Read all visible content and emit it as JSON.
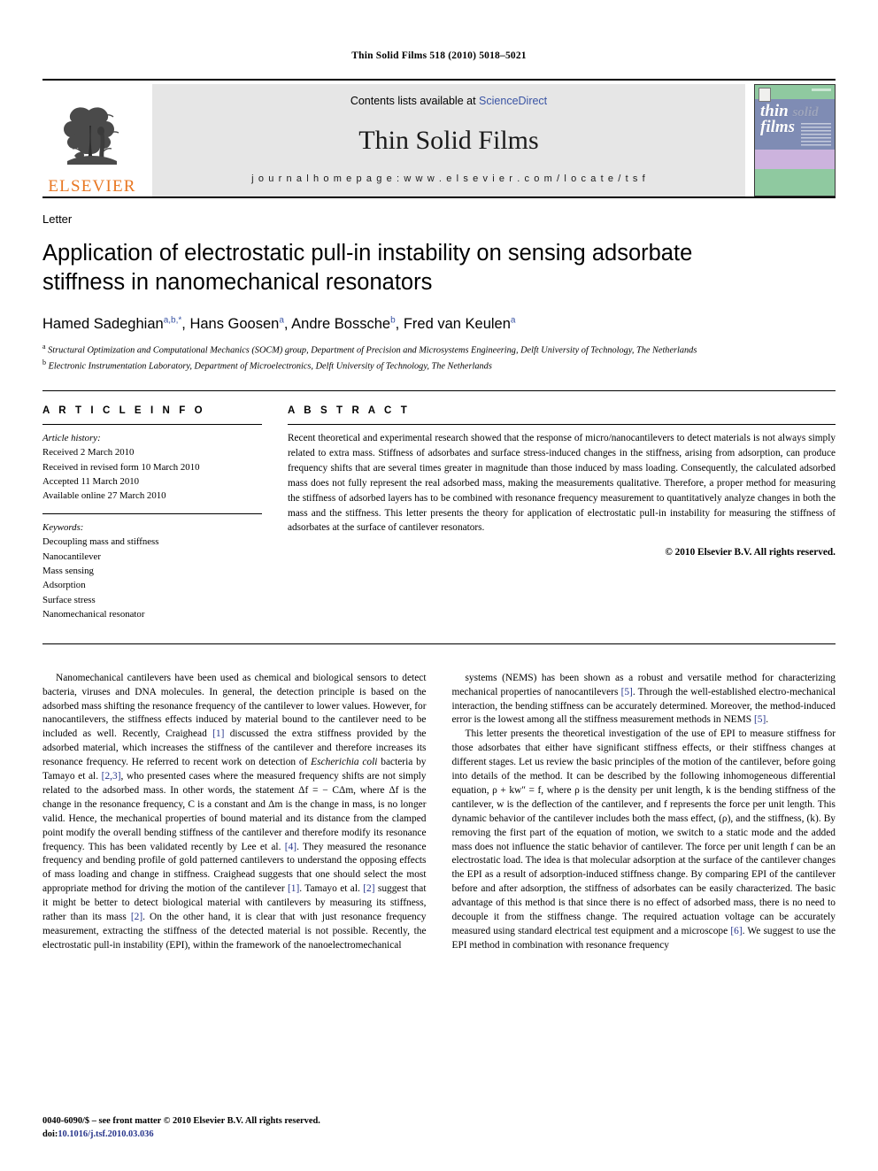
{
  "running_head": "Thin Solid Films 518 (2010) 5018–5021",
  "masthead": {
    "publisher_name": "ELSEVIER",
    "contents_prefix": "Contents lists available at",
    "contents_link": "ScienceDirect",
    "journal_title": "Thin Solid Films",
    "homepage_line": "j o u r n a l   h o m e p a g e :   w w w . e l s e v i e r . c o m / l o c a t e / t s f",
    "cover_word_1": "thin",
    "cover_word_faded": "solid",
    "cover_word_2": "films"
  },
  "article": {
    "section_type": "Letter",
    "title": "Application of electrostatic pull-in instability on sensing adsorbate stiffness in nanomechanical resonators",
    "authors": [
      {
        "name": "Hamed Sadeghian",
        "marks": "a,b,*",
        "sep": ", "
      },
      {
        "name": "Hans Goosen",
        "marks": "a",
        "sep": ", "
      },
      {
        "name": "Andre Bossche",
        "marks": "b",
        "sep": ", "
      },
      {
        "name": "Fred van Keulen",
        "marks": "a",
        "sep": ""
      }
    ],
    "affiliations": [
      {
        "mark": "a",
        "text": "Structural Optimization and Computational Mechanics (SOCM) group, Department of Precision and Microsystems Engineering, Delft University of Technology, The Netherlands"
      },
      {
        "mark": "b",
        "text": "Electronic Instrumentation Laboratory, Department of Microelectronics, Delft University of Technology, The Netherlands"
      }
    ]
  },
  "info": {
    "heading": "A R T I C L E   I N F O",
    "history_label": "Article history:",
    "history": [
      "Received 2 March 2010",
      "Received in revised form 10 March 2010",
      "Accepted 11 March 2010",
      "Available online 27 March 2010"
    ],
    "keywords_label": "Keywords:",
    "keywords": [
      "Decoupling mass and stiffness",
      "Nanocantilever",
      "Mass sensing",
      "Adsorption",
      "Surface stress",
      "Nanomechanical resonator"
    ]
  },
  "abstract": {
    "heading": "A B S T R A C T",
    "text": "Recent theoretical and experimental research showed that the response of micro/nanocantilevers to detect materials is not always simply related to extra mass. Stiffness of adsorbates and surface stress-induced changes in the stiffness, arising from adsorption, can produce frequency shifts that are several times greater in magnitude than those induced by mass loading. Consequently, the calculated adsorbed mass does not fully represent the real adsorbed mass, making the measurements qualitative. Therefore, a proper method for measuring the stiffness of adsorbed layers has to be combined with resonance frequency measurement to quantitatively analyze changes in both the mass and the stiffness. This letter presents the theory for application of electrostatic pull-in instability for measuring the stiffness of adsorbates at the surface of cantilever resonators.",
    "copyright": "© 2010 Elsevier B.V. All rights reserved."
  },
  "body": {
    "left_paragraph_1": "Nanomechanical cantilevers have been used as chemical and biological sensors to detect bacteria, viruses and DNA molecules. In general, the detection principle is based on the adsorbed mass shifting the resonance frequency of the cantilever to lower values. However, for nanocantilevers, the stiffness effects induced by material bound to the cantilever need to be included as well. Recently, Craighead [1] discussed the extra stiffness provided by the adsorbed material, which increases the stiffness of the cantilever and therefore increases its resonance frequency. He referred to recent work on detection of Escherichia coli bacteria by Tamayo et al. [2,3], who presented cases where the measured frequency shifts are not simply related to the adsorbed mass. In other words, the statement Δf = − CΔm, where Δf is the change in the resonance frequency, C is a constant and Δm is the change in mass, is no longer valid. Hence, the mechanical properties of bound material and its distance from the clamped point modify the overall bending stiffness of the cantilever and therefore modify its resonance frequency. This has been validated recently by Lee et al. [4]. They measured the resonance frequency and bending profile of gold patterned cantilevers to understand the opposing effects of mass loading and change in stiffness. Craighead suggests that one should select the most appropriate method for driving the motion of the cantilever [1]. Tamayo et al. [2] suggest that it might be better to detect biological material with cantilevers by measuring its stiffness, rather than its mass [2]. On the other hand, it is clear that with just resonance frequency measurement, extracting the stiffness of the detected material is not possible. Recently, the electrostatic pull-in instability (EPI), within the framework of the nanoelectromechanical",
    "right_paragraph_1": "systems (NEMS) has been shown as a robust and versatile method for characterizing mechanical properties of nanocantilevers [5]. Through the well-established electro-mechanical interaction, the bending stiffness can be accurately determined. Moreover, the method-induced error is the lowest among all the stiffness measurement methods in NEMS [5].",
    "right_paragraph_2": "This letter presents the theoretical investigation of the use of EPI to measure stiffness for those adsorbates that either have significant stiffness effects, or their stiffness changes at different stages. Let us review the basic principles of the motion of the cantilever, before going into details of the method. It can be described by the following inhomogeneous differential equation, ρ + kw″ = f, where ρ is the density per unit length, k is the bending stiffness of the cantilever, w is the deflection of the cantilever, and f represents the force per unit length. This dynamic behavior of the cantilever includes both the mass effect, (ρ), and the stiffness, (k). By removing the first part of the equation of motion, we switch to a static mode and the added mass does not influence the static behavior of cantilever. The force per unit length f can be an electrostatic load. The idea is that molecular adsorption at the surface of the cantilever changes the EPI as a result of adsorption-induced stiffness change. By comparing EPI of the cantilever before and after adsorption, the stiffness of adsorbates can be easily characterized. The basic advantage of this method is that since there is no effect of adsorbed mass, there is no need to decouple it from the stiffness change. The required actuation voltage can be accurately measured using standard electrical test equipment and a microscope [6]. We suggest to use the EPI method in combination with resonance frequency"
  },
  "footer": {
    "front_matter": "0040-6090/$ – see front matter © 2010 Elsevier B.V. All rights reserved.",
    "doi_label": "doi:",
    "doi_value": "10.1016/j.tsf.2010.03.036"
  },
  "colors": {
    "link_blue": "#3a54a4",
    "citation_blue": "#28368c",
    "elsevier_orange": "#E87722",
    "banner_gray": "#e6e6e6"
  }
}
